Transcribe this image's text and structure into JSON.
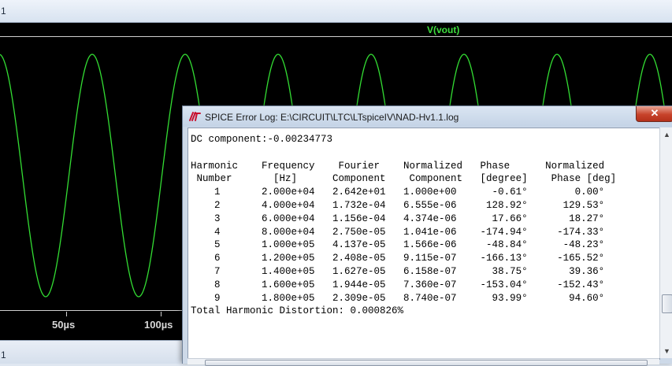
{
  "plot_window": {
    "title": "1",
    "trace_name": "V(vout)",
    "trace_color": "#33dd33",
    "x_ticks": [
      "50µs",
      "100µs"
    ],
    "status_text": "1"
  },
  "log_window": {
    "title": "SPICE Error Log: E:\\CIRCUIT\\LTC\\LTspiceIV\\NAD-Hv1.1.log",
    "close_icon": "close-icon",
    "dc_component": "DC component:-0.00234773",
    "header_line1": "Harmonic    Frequency    Fourier    Normalized   Phase      Normalized",
    "header_line2": " Number       [Hz]      Component    Component   [degree]    Phase [deg]",
    "rows": [
      "    1       2.000e+04   2.642e+01   1.000e+00      -0.61°        0.00°",
      "    2       4.000e+04   1.732e-04   6.555e-06     128.92°      129.53°",
      "    3       6.000e+04   1.156e-04   4.374e-06      17.66°       18.27°",
      "    4       8.000e+04   2.750e-05   1.041e-06    -174.94°     -174.33°",
      "    5       1.000e+05   4.137e-05   1.566e-06     -48.84°      -48.23°",
      "    6       1.200e+05   2.408e-05   9.115e-07    -166.13°     -165.52°",
      "    7       1.400e+05   1.627e-05   6.158e-07      38.75°       39.36°",
      "    8       1.600e+05   1.944e-05   7.360e-07    -153.04°     -152.43°",
      "    9       1.800e+05   2.309e-05   8.740e-07      93.99°       94.60°"
    ],
    "thd": "Total Harmonic Distortion: 0.000826%"
  }
}
